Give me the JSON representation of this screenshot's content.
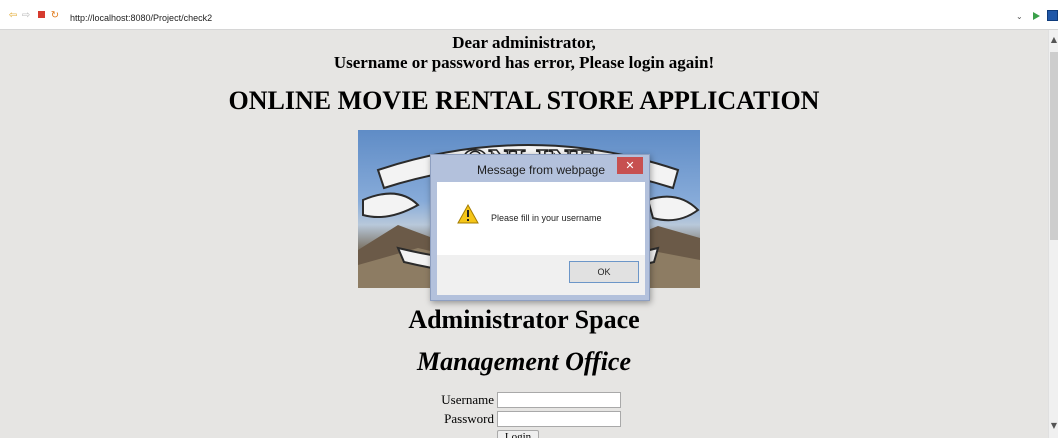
{
  "browser": {
    "url": "http://localhost:8080/Project/check2",
    "icons": [
      "back-icon",
      "forward-icon",
      "stop-icon",
      "refresh-icon",
      "url-dropdown-icon",
      "go-icon",
      "extension-icon"
    ],
    "dropdown_glyph": "⌄"
  },
  "page": {
    "greeting": "Dear administrator,",
    "error_message": "Username or password has error, Please login again!",
    "app_title": "ONLINE MOVIE RENTAL STORE APPLICATION",
    "admin_title": "Administrator Space",
    "office_title": "Management Office"
  },
  "banner": {
    "logo_text": "ONLINE"
  },
  "dialog": {
    "title": "Message from webpage",
    "close_glyph": "✕",
    "message": "Please fill in your username",
    "ok_label": "OK",
    "accent_color": "#c75050"
  },
  "login_form": {
    "username_label": "Username",
    "password_label": "Password",
    "username_value": "",
    "password_value": "",
    "submit_label": "Login"
  },
  "colors": {
    "page_background": "#e6e5e3",
    "dialog_frame": "#b3c1dc"
  }
}
